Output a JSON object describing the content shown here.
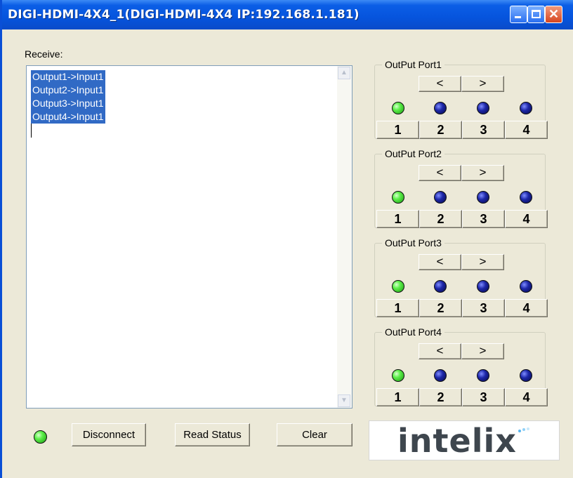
{
  "window": {
    "title": "DIGI-HDMI-4X4_1(DIGI-HDMI-4X4 IP:192.168.1.181)"
  },
  "title_buttons": {
    "minimize": "minimize",
    "maximize": "maximize",
    "close": "✕"
  },
  "receive": {
    "label": "Receive:",
    "lines": [
      "Output1->Input1",
      "Output2->Input1",
      "Output3->Input1",
      "Output4->Input1"
    ]
  },
  "ports": [
    {
      "label": "OutPut Port1",
      "prev": "<",
      "next": ">",
      "inputs": [
        "1",
        "2",
        "3",
        "4"
      ],
      "active_input": 1
    },
    {
      "label": "OutPut Port2",
      "prev": "<",
      "next": ">",
      "inputs": [
        "1",
        "2",
        "3",
        "4"
      ],
      "active_input": 1
    },
    {
      "label": "OutPut Port3",
      "prev": "<",
      "next": ">",
      "inputs": [
        "1",
        "2",
        "3",
        "4"
      ],
      "active_input": 1
    },
    {
      "label": "OutPut Port4",
      "prev": "<",
      "next": ">",
      "inputs": [
        "1",
        "2",
        "3",
        "4"
      ],
      "active_input": 1
    }
  ],
  "actions": {
    "disconnect": "Disconnect",
    "read_status": "Read Status",
    "clear": "Clear"
  },
  "logo": {
    "text": "intelix"
  },
  "colors": {
    "led_on": "#35d51f",
    "led_off": "#1d27a8",
    "selection": "#316ac5",
    "title_bar": "#0654dd"
  }
}
